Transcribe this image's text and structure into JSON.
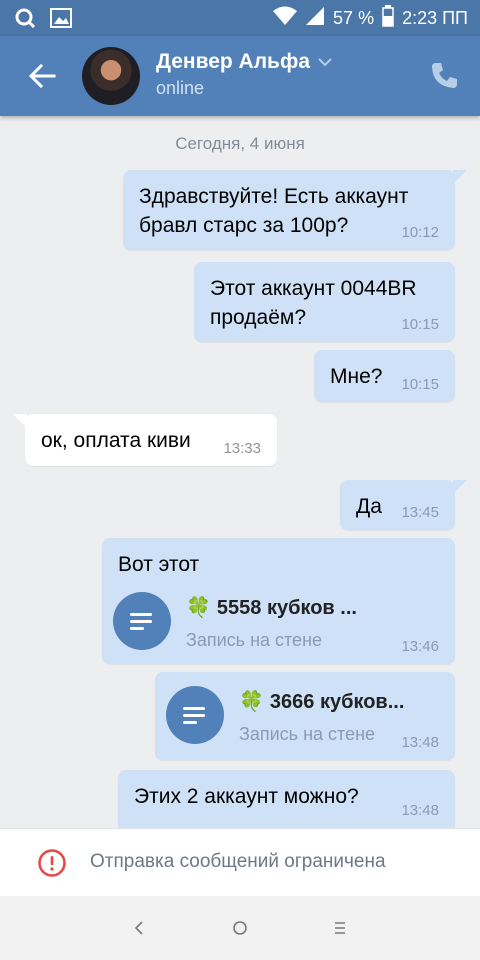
{
  "status_bar": {
    "battery_percent": "57 %",
    "time": "2:23 ПП"
  },
  "header": {
    "contact_name": "Денвер Альфа",
    "status": "online"
  },
  "chat": {
    "date_divider": "Сегодня, 4 июня",
    "messages": [
      {
        "dir": "out",
        "lines": [
          "Здравствуйте! Есть аккаунт",
          "бравл старс за 100р?"
        ],
        "time": "10:12"
      },
      {
        "dir": "out",
        "lines": [
          "Этот аккаунт 0044BR",
          "продаём?"
        ],
        "time": "10:15"
      },
      {
        "dir": "out",
        "text": "Мне?",
        "time": "10:15"
      },
      {
        "dir": "in",
        "text": "ок, оплата киви",
        "time": "13:33"
      },
      {
        "dir": "out",
        "text": "Да",
        "time": "13:45"
      },
      {
        "dir": "out",
        "text": "Вот этот",
        "attachment": {
          "title": "5558 кубков ...",
          "subtitle": "Запись на стене",
          "emoji": "🍀"
        },
        "time": "13:46"
      },
      {
        "dir": "out",
        "attachment": {
          "title": "3666 кубков...",
          "subtitle": "Запись на стене",
          "emoji": "🍀"
        },
        "time": "13:48"
      },
      {
        "dir": "out",
        "text": "Этих 2 аккаунт можно?",
        "time": "13:48"
      }
    ]
  },
  "banner": {
    "text": "Отправка сообщений ограничена"
  },
  "colors": {
    "header": "#5181b8",
    "status_bar": "#4a76a8",
    "outgoing_bubble": "#cfe1f7",
    "incoming_bubble": "#ffffff",
    "background": "#edeef0",
    "warning": "#e64646"
  },
  "icons": [
    "search-icon",
    "image-icon",
    "wifi-icon",
    "signal-icon",
    "battery-icon",
    "back-arrow-icon",
    "chevron-down-icon",
    "phone-icon",
    "post-icon",
    "warning-icon",
    "nav-back-icon",
    "nav-home-icon",
    "nav-recents-icon"
  ]
}
